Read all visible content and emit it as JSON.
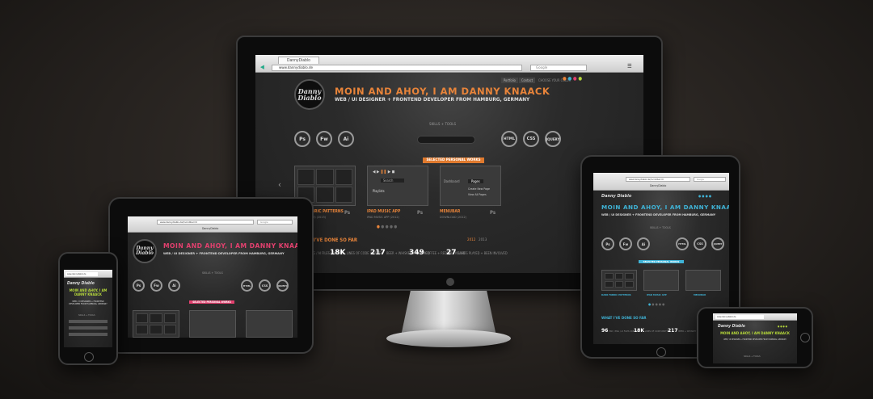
{
  "site": {
    "logo": "Danny Diablo",
    "headline": "MOIN AND AHOY, I AM DANNY KNAACK",
    "headline_mobile": "MOIN AND AHOY, I AM DANNY KNAACK",
    "subline": "WEB / UI DESIGNER + FRONTEND DEVELOPER FROM HAMBURG, GERMANY",
    "skills_label": "SKILLS + TOOLS",
    "skills": [
      "Ps",
      "Fw",
      "Ai",
      "HTML",
      "CSS",
      "JQUERY"
    ],
    "works_ribbon": "SELECTED PERSONAL WORKS",
    "works": [
      {
        "title": "DARK FABRIC PATTERNS",
        "meta": "DOWNLOAD (3) (2013)",
        "tag": "Ps"
      },
      {
        "title": "IPAD MUSIC APP",
        "meta": "IPAD MUSIC APP (2012)",
        "tag": "Ps"
      },
      {
        "title": "MENUBAR",
        "meta": "DOWNLOAD (2012)",
        "tag": "Ps"
      }
    ],
    "done_title": "WHAT I'VE DONE SO FAR",
    "years": [
      "2012",
      "2013"
    ],
    "stats": [
      {
        "value": "96",
        "label": "PSD / PNG / AI FILES CREATED"
      },
      {
        "value": "18K",
        "label": "LINES OF CODE WRITTEN"
      },
      {
        "value": "217",
        "label": "BEER + WHISKEY CONSUMED"
      },
      {
        "value": "349",
        "label": "COFFEE + REDBULL KILLED"
      },
      {
        "value": "27",
        "label": "GAMES PLAYED + BEEN INVOLVED"
      }
    ],
    "topnav": [
      "Portfolio",
      "Contact"
    ],
    "color_label": "CHOOSE YOUR COLOR",
    "playlists": "Playlists",
    "search": "Search",
    "pages": "Pages",
    "dashboard": "Dashboard",
    "create_page": "Create New Page",
    "view_all": "View All Pages"
  },
  "browser": {
    "tab_title": "DannyDiablo",
    "url": "www.dannydiablo.de",
    "url_tablet": "www.dannydiablo.de/?scrollbar=0",
    "search_placeholder": "Google"
  },
  "colors": {
    "orange": "#e8843a",
    "pink": "#e2406e",
    "blue": "#3fb3d6",
    "green": "#b6d93a"
  }
}
